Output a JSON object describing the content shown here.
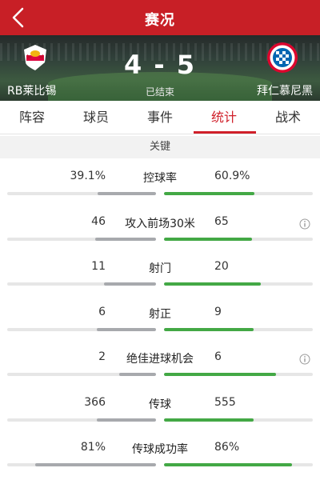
{
  "header": {
    "title": "赛况",
    "back_icon": "chevron-left-icon"
  },
  "match": {
    "home_team": "RB莱比锡",
    "away_team": "拜仁慕尼黑",
    "score": "4 - 5",
    "status": "已结束",
    "home_logo": "rb-leipzig-logo",
    "away_logo": "bayern-munich-logo"
  },
  "tabs": [
    {
      "label": "阵容",
      "active": false
    },
    {
      "label": "球员",
      "active": false
    },
    {
      "label": "事件",
      "active": false
    },
    {
      "label": "统计",
      "active": true
    },
    {
      "label": "战术",
      "active": false
    }
  ],
  "section": {
    "title": "关键"
  },
  "stats": [
    {
      "label": "控球率",
      "home": "39.1%",
      "away": "60.9%",
      "home_fill": 0.39,
      "away_fill": 0.61,
      "info": false
    },
    {
      "label": "攻入前场30米",
      "home": "46",
      "away": "65",
      "home_fill": 0.41,
      "away_fill": 0.59,
      "info": true
    },
    {
      "label": "射门",
      "home": "11",
      "away": "20",
      "home_fill": 0.35,
      "away_fill": 0.65,
      "info": false
    },
    {
      "label": "射正",
      "home": "6",
      "away": "9",
      "home_fill": 0.4,
      "away_fill": 0.6,
      "info": false
    },
    {
      "label": "绝佳进球机会",
      "home": "2",
      "away": "6",
      "home_fill": 0.25,
      "away_fill": 0.75,
      "info": true
    },
    {
      "label": "传球",
      "home": "366",
      "away": "555",
      "home_fill": 0.4,
      "away_fill": 0.6,
      "info": false
    },
    {
      "label": "传球成功率",
      "home": "81%",
      "away": "86%",
      "home_fill": 0.81,
      "away_fill": 0.86,
      "info": false
    }
  ],
  "colors": {
    "brand_red": "#c81f26",
    "home_bar": "#a7a9ad",
    "away_bar": "#43a845",
    "active_tab": "#d0202a"
  }
}
